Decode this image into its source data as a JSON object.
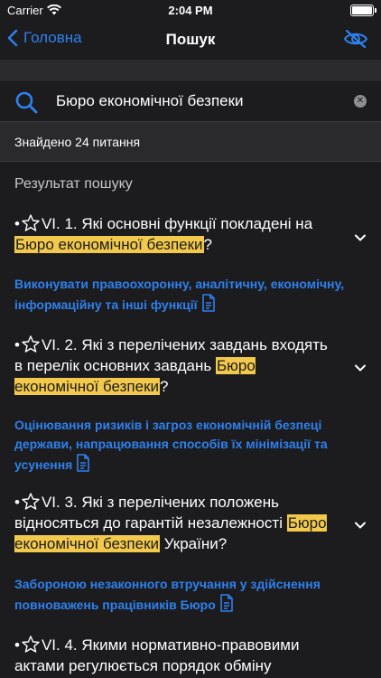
{
  "status": {
    "carrier": "Carrier",
    "time": "2:04 PM"
  },
  "nav": {
    "back_label": "Головна",
    "title": "Пошук"
  },
  "search": {
    "value": "Бюро економічної безпеки"
  },
  "results_count": "Знайдено 24 питання",
  "section_title": "Результат пошуку",
  "items": [
    {
      "q_pre": "VI. 1. Які основні функції покладені на",
      "q_hl": "Бюро економічної безпеки",
      "q_post": "?",
      "answer": "Виконувати правоохоронну, аналітичну, економічну, інформаційну та інші функції"
    },
    {
      "q_pre": "VI. 2. Які з перелічених завдань входять в перелік основних завдань",
      "q_hl": "Бюро економічної безпеки",
      "q_post": "?",
      "answer": "Оцінювання ризиків і загроз економічній безпеці держави, напрацювання способів їх мінімізації та усунення"
    },
    {
      "q_pre": "VI. 3. Які з перелічених положень відносяться до гарантій незалежності",
      "q_hl": "Бюро економічної безпеки",
      "q_post": " України?",
      "answer": "Забороною незаконного втручання у здійснення повноважень працівників Бюро"
    },
    {
      "q_pre": "VI. 4. Якими нормативно-правовими актами регулюється порядок обміну",
      "q_hl": "",
      "q_post": ""
    }
  ]
}
